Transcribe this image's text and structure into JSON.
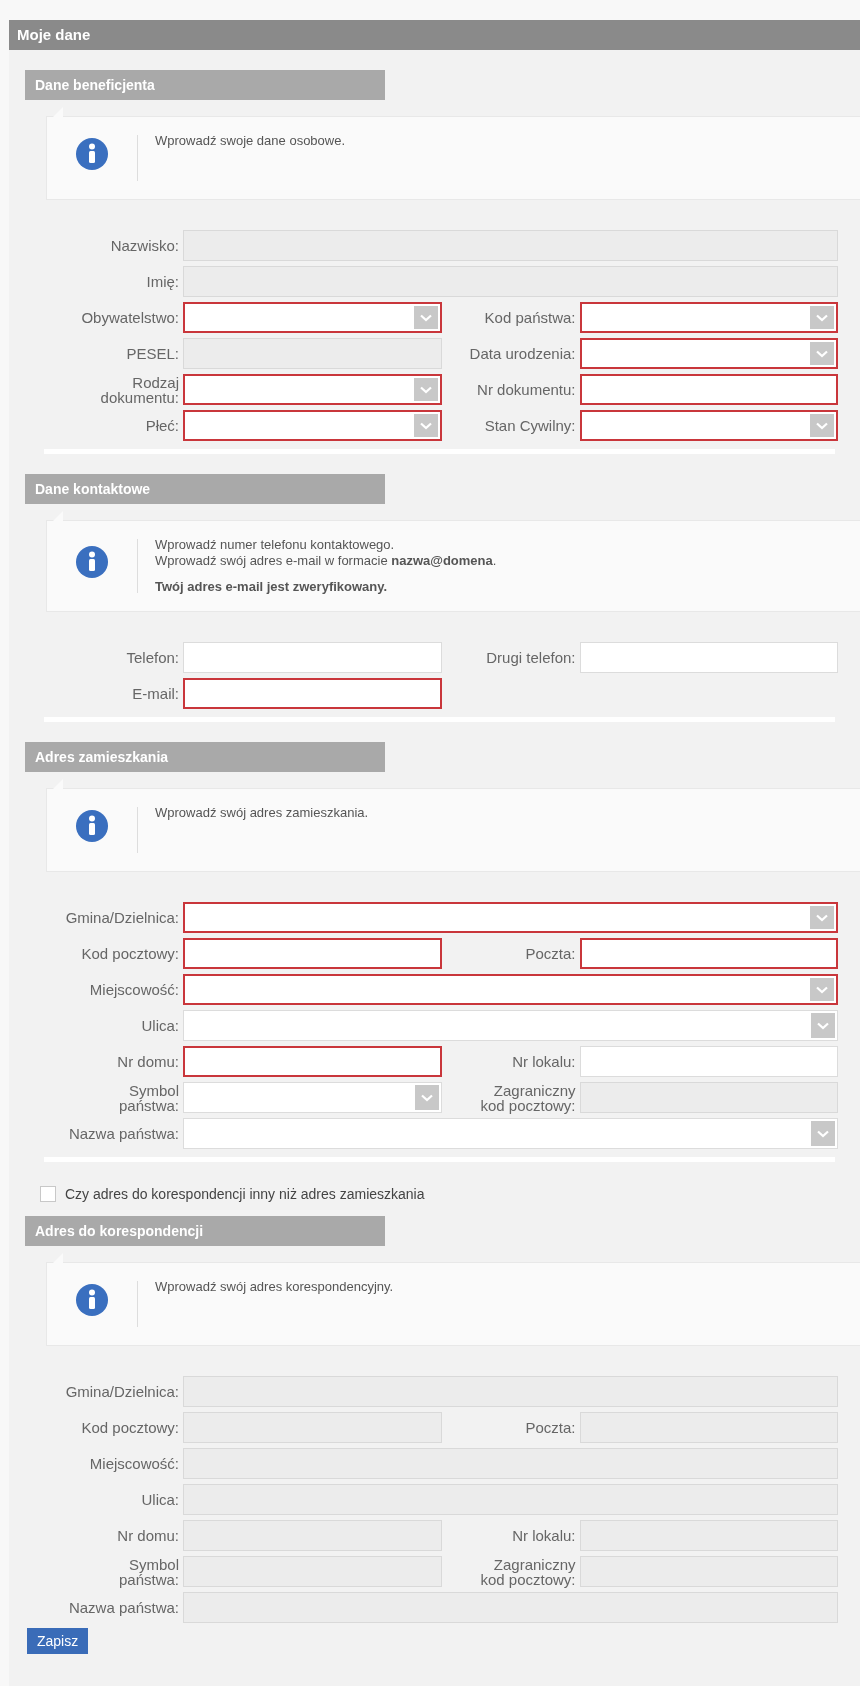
{
  "page_title": "Moje dane",
  "sections": [
    {
      "title": "Dane beneficjenta",
      "info": [
        {
          "text": "Wprowadź swoje dane osobowe.",
          "emphasis": false
        }
      ],
      "rows": [
        [
          {
            "label": "Nazwisko:",
            "kind": "text",
            "wide": true,
            "invalid": false,
            "disabled": true
          }
        ],
        [
          {
            "label": "Imię:",
            "kind": "text",
            "wide": true,
            "invalid": false,
            "disabled": true
          }
        ],
        [
          {
            "label": "Obywatelstwo:",
            "kind": "select",
            "wide": false,
            "invalid": true,
            "disabled": false
          },
          {
            "label": "Kod państwa:",
            "kind": "select",
            "wide": false,
            "invalid": true,
            "disabled": false
          }
        ],
        [
          {
            "label": "PESEL:",
            "kind": "text",
            "wide": false,
            "invalid": false,
            "disabled": true
          },
          {
            "label": "Data urodzenia:",
            "kind": "select",
            "wide": false,
            "invalid": true,
            "disabled": false
          }
        ],
        [
          {
            "label": "Rodzaj\ndokumentu:",
            "kind": "select",
            "wide": false,
            "invalid": true,
            "disabled": false
          },
          {
            "label": "Nr dokumentu:",
            "kind": "text",
            "wide": false,
            "invalid": true,
            "disabled": false
          }
        ],
        [
          {
            "label": "Płeć:",
            "kind": "select",
            "wide": false,
            "invalid": true,
            "disabled": false
          },
          {
            "label": "Stan Cywilny:",
            "kind": "select",
            "wide": false,
            "invalid": true,
            "disabled": false
          }
        ]
      ]
    },
    {
      "title": "Dane kontaktowe",
      "info": [
        {
          "text": "Wprowadź numer telefonu kontaktowego.",
          "emphasis": false
        },
        {
          "text": "Wprowadź swój adres e-mail w formacie **nazwa@domena**.",
          "emphasis": false
        },
        {
          "text": "Twój adres e-mail jest zweryfikowany.",
          "emphasis": true
        }
      ],
      "rows": [
        [
          {
            "label": "Telefon:",
            "kind": "text",
            "wide": false,
            "invalid": false,
            "disabled": false
          },
          {
            "label": "Drugi telefon:",
            "kind": "text",
            "wide": false,
            "invalid": false,
            "disabled": false
          }
        ],
        [
          {
            "label": "E-mail:",
            "kind": "text",
            "wide": false,
            "invalid": true,
            "disabled": false
          }
        ]
      ]
    },
    {
      "title": "Adres zamieszkania",
      "info": [
        {
          "text": "Wprowadź swój adres zamieszkania.",
          "emphasis": false
        }
      ],
      "rows": [
        [
          {
            "label": "Gmina/Dzielnica:",
            "kind": "select",
            "wide": true,
            "invalid": true,
            "disabled": false
          }
        ],
        [
          {
            "label": "Kod pocztowy:",
            "kind": "text",
            "wide": false,
            "invalid": true,
            "disabled": false
          },
          {
            "label": "Poczta:",
            "kind": "text",
            "wide": false,
            "invalid": true,
            "disabled": false
          }
        ],
        [
          {
            "label": "Miejscowość:",
            "kind": "select",
            "wide": true,
            "invalid": true,
            "disabled": false
          }
        ],
        [
          {
            "label": "Ulica:",
            "kind": "select",
            "wide": true,
            "invalid": false,
            "disabled": false
          }
        ],
        [
          {
            "label": "Nr domu:",
            "kind": "text",
            "wide": false,
            "invalid": true,
            "disabled": false
          },
          {
            "label": "Nr lokalu:",
            "kind": "text",
            "wide": false,
            "invalid": false,
            "disabled": false
          }
        ],
        [
          {
            "label": "Symbol\npaństwa:",
            "kind": "select",
            "wide": false,
            "invalid": false,
            "disabled": false
          },
          {
            "label": "Zagraniczny\nkod pocztowy:",
            "kind": "text",
            "wide": false,
            "invalid": false,
            "disabled": true
          }
        ],
        [
          {
            "label": "Nazwa państwa:",
            "kind": "select",
            "wide": true,
            "invalid": false,
            "disabled": false
          }
        ]
      ]
    },
    {
      "toggle": {
        "label": "Czy adres do korespondencji inny niż adres zamieszkania",
        "checked": false
      },
      "title": "Adres do korespondencji",
      "info": [
        {
          "text": "Wprowadź swój adres korespondencyjny.",
          "emphasis": false
        }
      ],
      "rows": [
        [
          {
            "label": "Gmina/Dzielnica:",
            "kind": "text",
            "wide": true,
            "invalid": false,
            "disabled": true
          }
        ],
        [
          {
            "label": "Kod pocztowy:",
            "kind": "text",
            "wide": false,
            "invalid": false,
            "disabled": true
          },
          {
            "label": "Poczta:",
            "kind": "text",
            "wide": false,
            "invalid": false,
            "disabled": true
          }
        ],
        [
          {
            "label": "Miejscowość:",
            "kind": "text",
            "wide": true,
            "invalid": false,
            "disabled": true
          }
        ],
        [
          {
            "label": "Ulica:",
            "kind": "text",
            "wide": true,
            "invalid": false,
            "disabled": true
          }
        ],
        [
          {
            "label": "Nr domu:",
            "kind": "text",
            "wide": false,
            "invalid": false,
            "disabled": true
          },
          {
            "label": "Nr lokalu:",
            "kind": "text",
            "wide": false,
            "invalid": false,
            "disabled": true
          }
        ],
        [
          {
            "label": "Symbol\npaństwa:",
            "kind": "text",
            "wide": false,
            "invalid": false,
            "disabled": true
          },
          {
            "label": "Zagraniczny\nkod pocztowy:",
            "kind": "text",
            "wide": false,
            "invalid": false,
            "disabled": true
          }
        ],
        [
          {
            "label": "Nazwa państwa:",
            "kind": "text",
            "wide": true,
            "invalid": false,
            "disabled": true
          }
        ]
      ]
    }
  ],
  "save_button": "Zapisz"
}
